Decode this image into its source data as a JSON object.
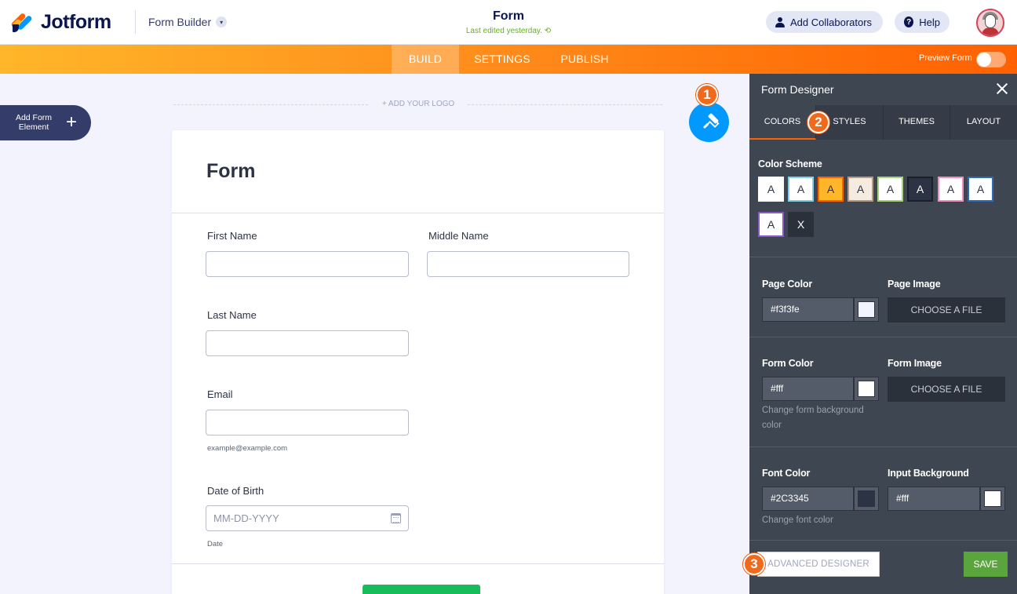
{
  "header": {
    "brand": "Jotform",
    "form_builder": "Form Builder",
    "form_title": "Form",
    "last_edited": "Last edited yesterday.",
    "add_collaborators": "Add Collaborators",
    "help": "Help"
  },
  "nav": {
    "tabs": [
      "BUILD",
      "SETTINGS",
      "PUBLISH"
    ],
    "active_tab": "BUILD",
    "preview_form": "Preview Form",
    "preview_enabled": false
  },
  "canvas": {
    "add_form_element": "Add Form Element",
    "add_logo": "+ ADD YOUR LOGO",
    "form_heading": "Form",
    "fields": {
      "first_name": "First Name",
      "middle_name": "Middle Name",
      "last_name": "Last Name",
      "email": "Email",
      "email_sublabel": "example@example.com",
      "dob": "Date of Birth",
      "dob_placeholder": "MM-DD-YYYY",
      "dob_sublabel": "Date"
    }
  },
  "designer": {
    "title": "Form Designer",
    "tabs": [
      "COLORS",
      "STYLES",
      "THEMES",
      "LAYOUT"
    ],
    "active_tab": "COLORS",
    "color_scheme_label": "Color Scheme",
    "color_schemes": [
      {
        "label": "A",
        "bg": "#ffffff",
        "border": "#ffffff",
        "text": "#2c3345"
      },
      {
        "label": "A",
        "bg": "#ffffff",
        "border": "#7fd0e8",
        "text": "#2c3345"
      },
      {
        "label": "A",
        "bg": "#ffb629",
        "border": "#ff6100",
        "text": "#2c3345"
      },
      {
        "label": "A",
        "bg": "#f5ecdf",
        "border": "#b59a86",
        "text": "#2c3345"
      },
      {
        "label": "A",
        "bg": "#ffffff",
        "border": "#a5d37a",
        "text": "#2c3345"
      },
      {
        "label": "A",
        "bg": "#2c3345",
        "border": "#1a1f28",
        "text": "#ffffff"
      },
      {
        "label": "A",
        "bg": "#ffffff",
        "border": "#f08fb8",
        "text": "#2c3345"
      },
      {
        "label": "A",
        "bg": "#ffffff",
        "border": "#2f6bb3",
        "text": "#2c3345"
      },
      {
        "label": "A",
        "bg": "#ffffff",
        "border": "#8b58c7",
        "text": "#2c3345"
      },
      {
        "label": "X",
        "bg": "#2b313a",
        "border": "#2b313a",
        "text": "#ffffff"
      }
    ],
    "page_color_label": "Page Color",
    "page_color": "#f3f3fe",
    "page_image_label": "Page Image",
    "choose_file": "CHOOSE A FILE",
    "form_color_label": "Form Color",
    "form_color": "#fff",
    "form_image_label": "Form Image",
    "form_color_help": "Change form background color",
    "font_color_label": "Font Color",
    "font_color": "#2C3345",
    "font_color_help": "Change font color",
    "input_bg_label": "Input Background",
    "input_bg": "#fff",
    "advanced_designer": "ADVANCED DESIGNER",
    "save": "SAVE"
  },
  "annotations": [
    "1",
    "2",
    "3"
  ],
  "colors": {
    "accent_orange": "#ff6100",
    "roller_blue": "#0099ff",
    "badge": "#f06a1d",
    "panel": "#3e4652",
    "save_green": "#5aa63c"
  }
}
